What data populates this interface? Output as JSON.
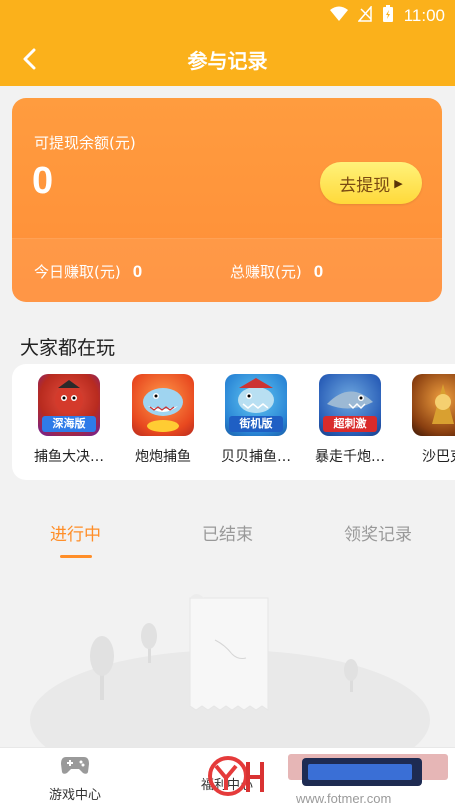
{
  "status_bar": {
    "time": "11:00"
  },
  "nav": {
    "title": "参与记录"
  },
  "balance": {
    "label": "可提现余额(元)",
    "value": "0",
    "withdraw_label": "去提现",
    "today_label": "今日赚取(元)",
    "today_value": "0",
    "total_label": "总赚取(元)",
    "total_value": "0"
  },
  "games_section": {
    "title": "大家都在玩",
    "games": [
      {
        "label": "捕鱼大决…",
        "banner": "深海版"
      },
      {
        "label": "炮炮捕鱼",
        "banner": ""
      },
      {
        "label": "贝贝捕鱼…",
        "banner": "街机版"
      },
      {
        "label": "暴走千炮…",
        "banner": "超刺激"
      },
      {
        "label": "沙巴克",
        "banner": ""
      }
    ]
  },
  "tabs": [
    {
      "label": "进行中",
      "active": true
    },
    {
      "label": "已结束",
      "active": false
    },
    {
      "label": "领奖记录",
      "active": false
    }
  ],
  "bottom_nav": [
    {
      "label": "游戏中心"
    },
    {
      "label": "福利中心"
    }
  ],
  "colors": {
    "primary": "#fbb11b",
    "card": "#ff8e38",
    "accent": "#ff8e28"
  }
}
